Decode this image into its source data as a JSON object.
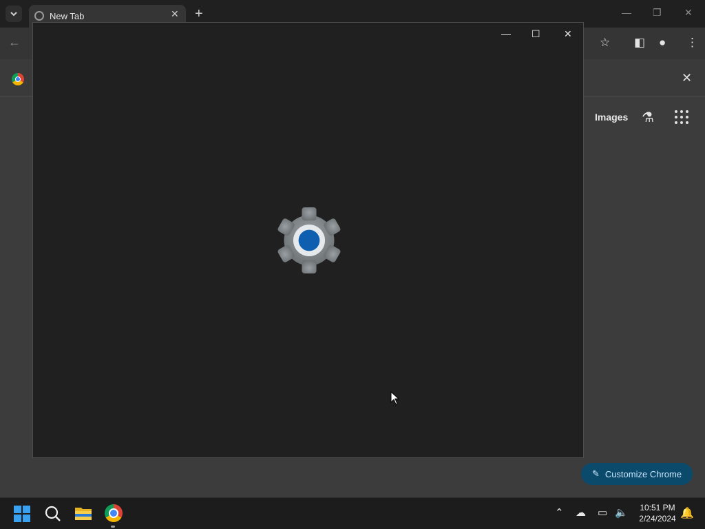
{
  "browser": {
    "tab": {
      "title": "New Tab",
      "close_glyph": "✕"
    },
    "new_tab_glyph": "+",
    "window_controls": {
      "minimize": "—",
      "restore": "❐",
      "close": "✕"
    },
    "toolbar": {
      "back_glyph": "←",
      "bookmark_glyph": "☆",
      "sidepanel_glyph": "◧",
      "profile_glyph": "●",
      "menu_glyph": "⋮"
    },
    "side_panel": {
      "close_glyph": "✕"
    },
    "ntp": {
      "images_label": "Images",
      "labs_glyph": "⚗",
      "customize_label": "Customize Chrome",
      "customize_icon_glyph": "✎"
    }
  },
  "settings_window": {
    "controls": {
      "minimize": "—",
      "maximize": "☐",
      "close": "✕"
    },
    "icon": "gear-icon",
    "colors": {
      "gear": "#8e9396",
      "core": "#0f5fb0",
      "ring": "#e6e9ec"
    }
  },
  "taskbar": {
    "tray": {
      "chevron_glyph": "⌃",
      "cloud_glyph": "☁",
      "network_glyph": "▭",
      "volume_glyph": "🔈"
    },
    "clock": {
      "time": "10:51 PM",
      "date": "2/24/2024"
    },
    "bell_glyph": "🔔"
  }
}
